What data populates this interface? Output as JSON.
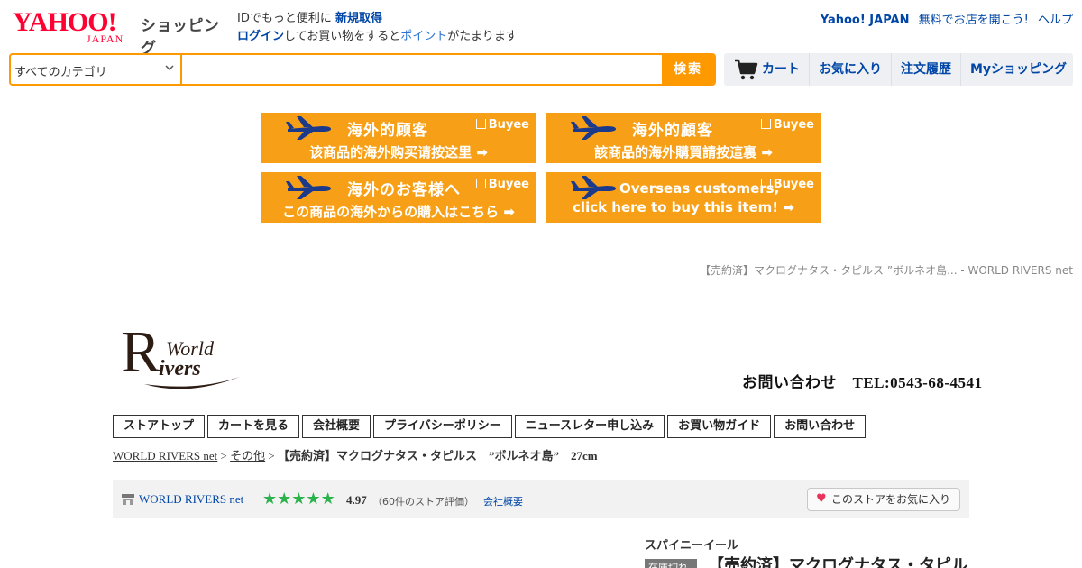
{
  "header": {
    "logo_main": "YAHOO!",
    "logo_sub": "JAPAN",
    "logo_service": "ショッピング",
    "id_text": "IDでもっと便利に",
    "signup_link": "新規取得",
    "login_link": "ログイン",
    "login_suffix": "してお買い物をすると",
    "points_link": "ポイント",
    "points_suffix": "がたまります",
    "top_links": [
      "Yahoo! JAPAN",
      "無料でお店を開こう!",
      "ヘルプ"
    ]
  },
  "search": {
    "category": "すべてのカテゴリ",
    "query": "",
    "placeholder": "",
    "button": "検索"
  },
  "nav": {
    "cart": "カート",
    "favorites": "お気に入り",
    "orders": "注文履歴",
    "my": "Myショッピング"
  },
  "banners": [
    {
      "line1": "海外的顾客",
      "line2": "该商品的海外购买请按这里 ➡",
      "brand": "Buyee"
    },
    {
      "line1": "海外的顧客",
      "line2": "該商品的海外購買請按這裏 ➡",
      "brand": "Buyee"
    },
    {
      "line1": "海外のお客様へ",
      "line2": "この商品の海外からの購入はこちら ➡",
      "brand": "Buyee"
    },
    {
      "line1": "Overseas customers,",
      "line2": "click here to buy this item! ➡",
      "brand": "Buyee"
    }
  ],
  "page_crumb": "【売約済】マクログナタス・タピルス ”ボルネオ島... - WORLD RIVERS net",
  "store": {
    "logo_R": "R",
    "logo_line1": "World",
    "logo_line2": "ivers",
    "contact": "お問い合わせ　TEL:0543-68-4541",
    "menu": [
      "ストアトップ",
      "カートを見る",
      "会社概要",
      "プライバシーポリシー",
      "ニュースレター申し込み",
      "お買い物ガイド",
      "お問い合わせ"
    ],
    "breadcrumb": {
      "home": "WORLD RIVERS net",
      "sep": ">",
      "category": "その他",
      "current": "【売約済】マクログナタス・タピルス　”ボルネオ島”　27cm"
    },
    "bar": {
      "name": "WORLD RIVERS net",
      "rating": 4.97,
      "rating_text": "4.97",
      "reviews": "（60件のストア評価）",
      "company": "会社概要",
      "favorite": "このストアをお気に入り"
    }
  },
  "product": {
    "category": "スパイニーイール",
    "badge": "在庫切れ",
    "title": "【売約済】マクログナタス・タピル"
  },
  "colors": {
    "accent": "#ff9900",
    "link": "#0046a6",
    "yahoo_red": "#ff0033",
    "star_green": "#2bb24c"
  }
}
